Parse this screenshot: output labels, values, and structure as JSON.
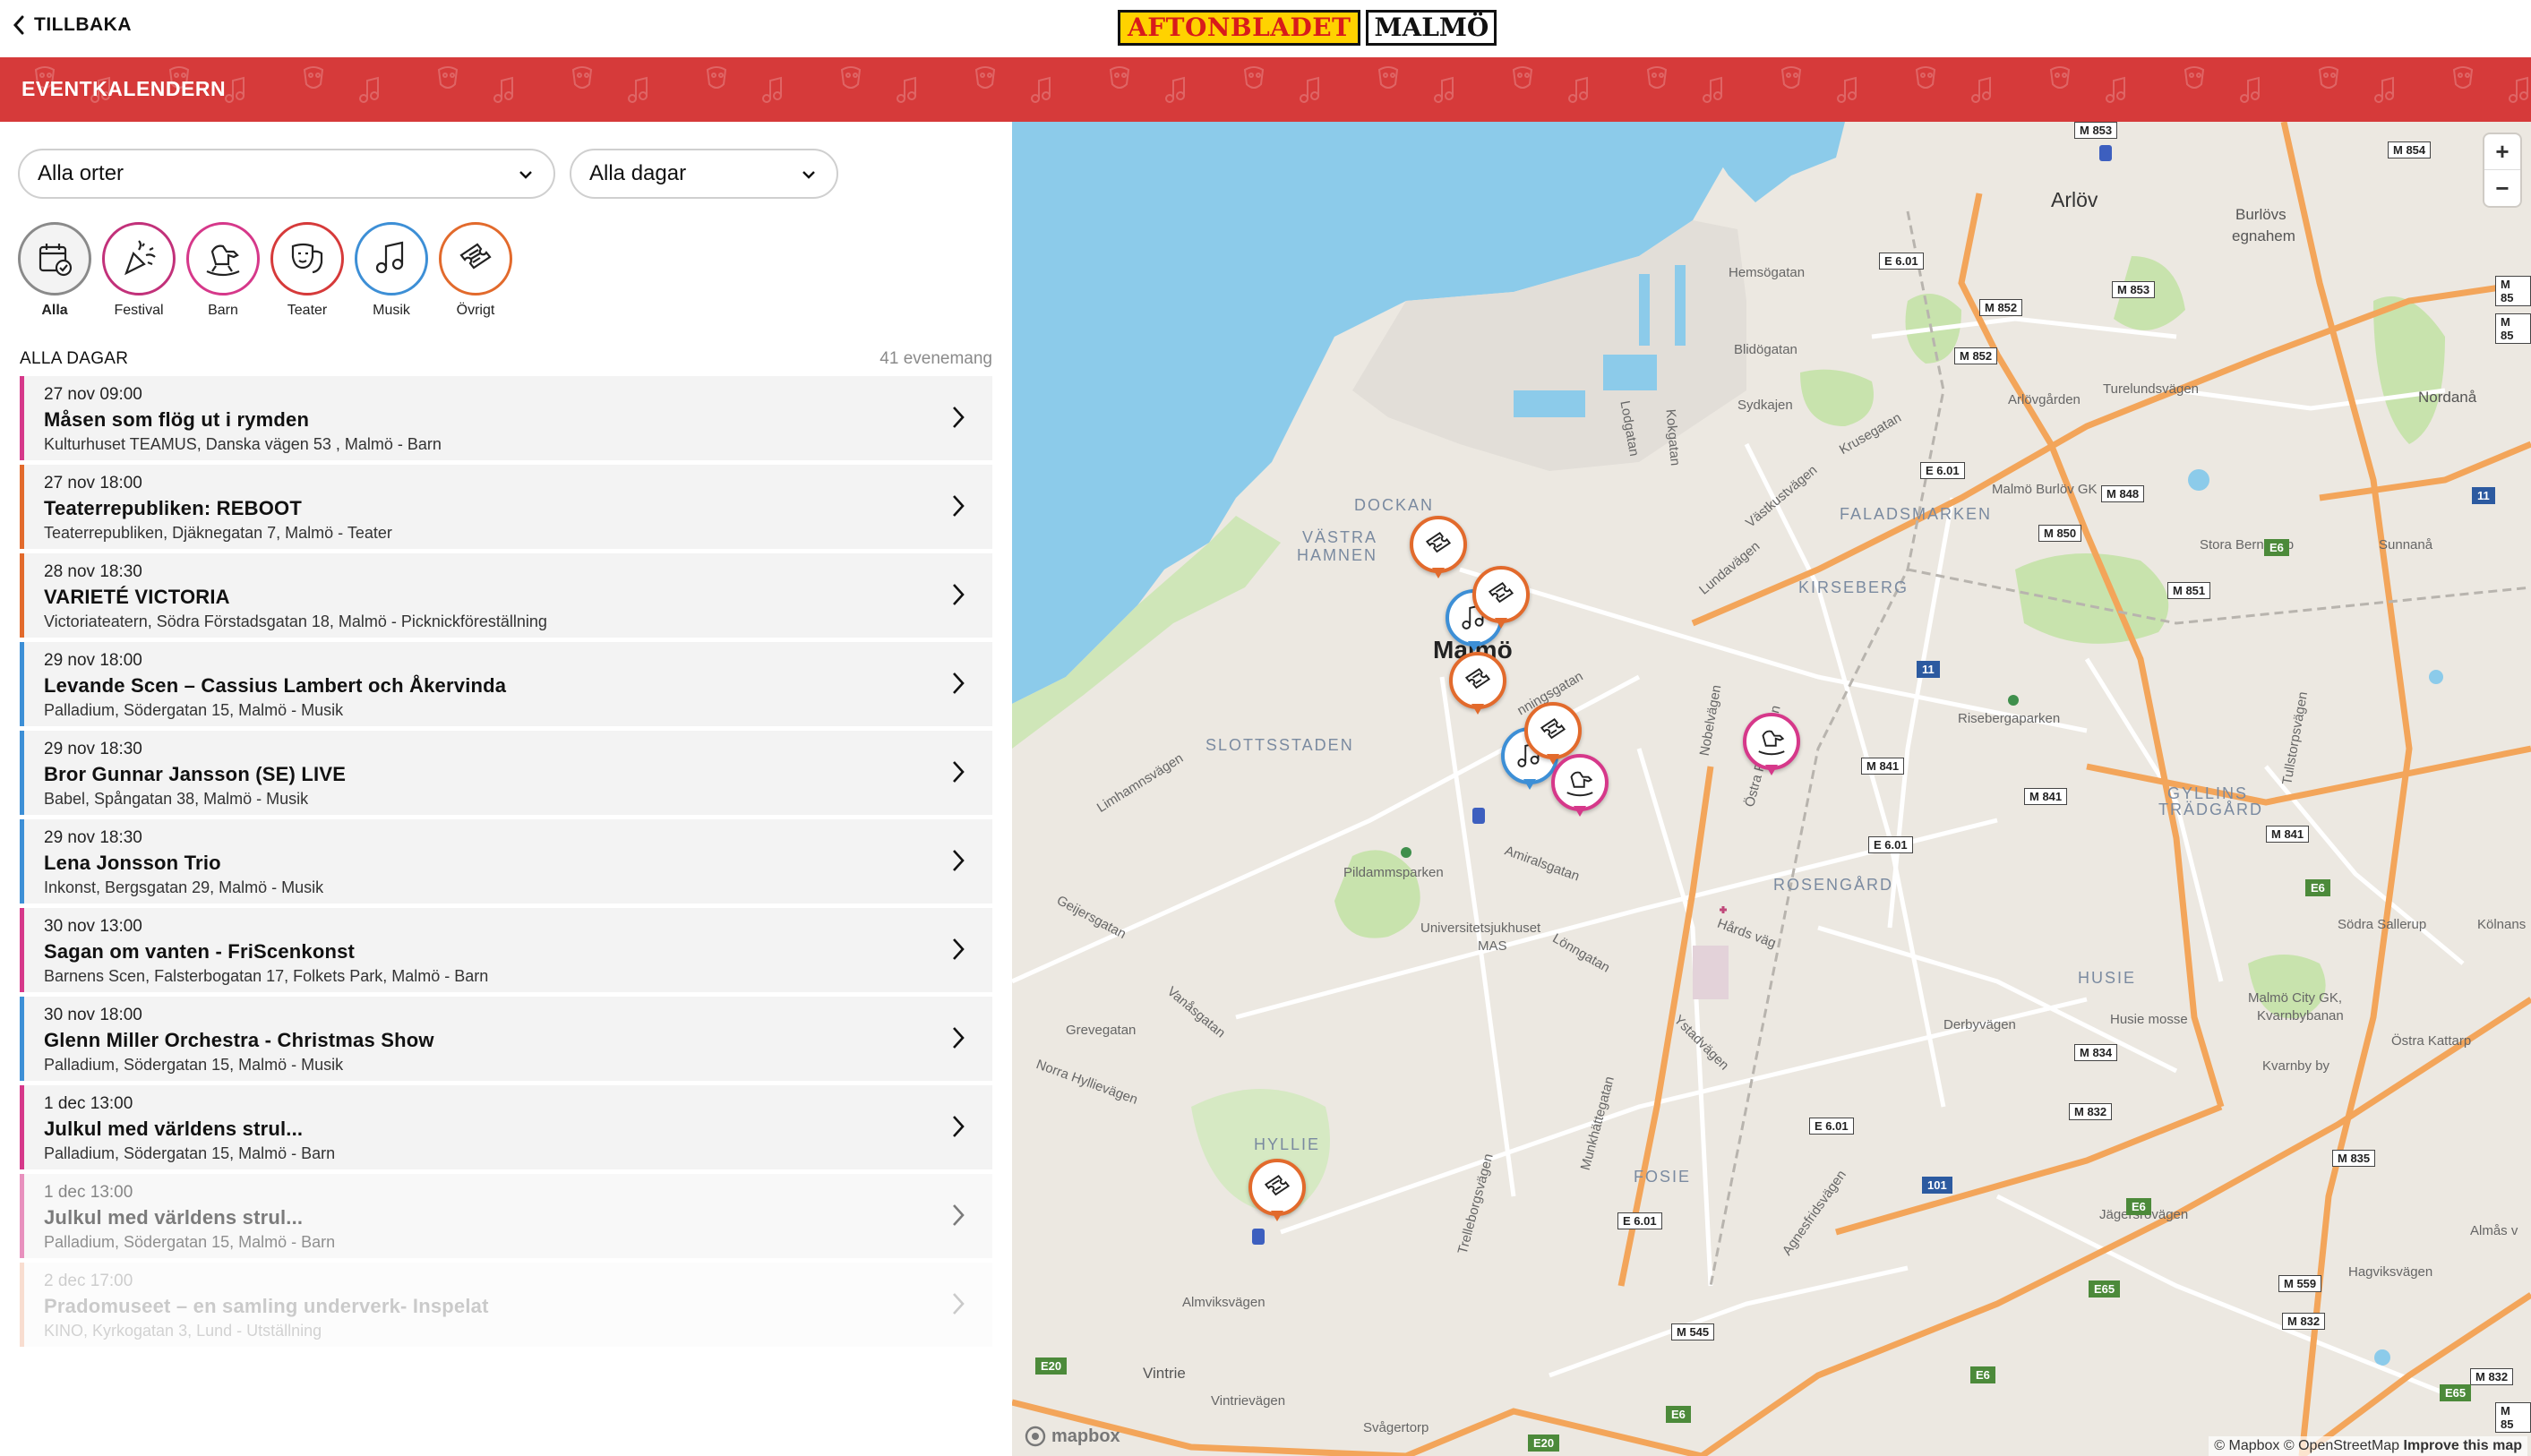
{
  "header": {
    "back_label": "TILLBAKA",
    "logo_brand": "AFTONBLADET",
    "logo_city": "MALMÖ",
    "section_title": "EVENTKALENDERN"
  },
  "filters": {
    "location": "Alla orter",
    "days": "Alla dagar"
  },
  "categories": [
    {
      "label": "Alla",
      "icon": "calendar-check-icon",
      "color": "#8a8a8a",
      "active": true
    },
    {
      "label": "Festival",
      "icon": "party-popper-icon",
      "color": "#c2317a"
    },
    {
      "label": "Barn",
      "icon": "rocking-horse-icon",
      "color": "#d6388a"
    },
    {
      "label": "Teater",
      "icon": "theater-masks-icon",
      "color": "#d63a3a"
    },
    {
      "label": "Musik",
      "icon": "music-note-icon",
      "color": "#3d8fd6"
    },
    {
      "label": "Övrigt",
      "icon": "ticket-icon",
      "color": "#e26a2c"
    }
  ],
  "list": {
    "heading": "ALLA DAGAR",
    "count": "41 evenemang",
    "events": [
      {
        "datetime": "27 nov 09:00",
        "name": "Måsen som flög ut i rymden",
        "location": "Kulturhuset TEAMUS, Danska vägen 53 , Malmö - Barn",
        "color": "#d6388a"
      },
      {
        "datetime": "27 nov 18:00",
        "name": "Teaterrepubliken: REBOOT",
        "location": "Teaterrepubliken, Djäknegatan 7, Malmö - Teater",
        "color": "#e26a2c"
      },
      {
        "datetime": "28 nov 18:30",
        "name": "VARIETÉ VICTORIA",
        "location": "Victoriateatern, Södra Förstadsgatan 18, Malmö - Picknickföreställning",
        "color": "#e26a2c"
      },
      {
        "datetime": "29 nov 18:00",
        "name": "Levande Scen – Cassius Lambert och Åkervinda",
        "location": "Palladium, Södergatan 15, Malmö - Musik",
        "color": "#3d8fd6"
      },
      {
        "datetime": "29 nov 18:30",
        "name": "Bror Gunnar Jansson (SE) LIVE",
        "location": "Babel, Spångatan 38, Malmö - Musik",
        "color": "#3d8fd6"
      },
      {
        "datetime": "29 nov 18:30",
        "name": "Lena Jonsson Trio",
        "location": "Inkonst, Bergsgatan 29, Malmö - Musik",
        "color": "#3d8fd6"
      },
      {
        "datetime": "30 nov 13:00",
        "name": "Sagan om vanten - FriScenkonst",
        "location": "Barnens Scen, Falsterbogatan 17, Folkets Park, Malmö - Barn",
        "color": "#d6388a"
      },
      {
        "datetime": "30 nov 18:00",
        "name": "Glenn Miller Orchestra - Christmas Show",
        "location": "Palladium, Södergatan 15, Malmö - Musik",
        "color": "#3d8fd6"
      },
      {
        "datetime": "1 dec 13:00",
        "name": "Julkul med världens strul...",
        "location": "Palladium, Södergatan 15, Malmö - Barn",
        "color": "#d6388a"
      },
      {
        "datetime": "1 dec 13:00",
        "name": "Julkul med världens strul...",
        "location": "Palladium, Södergatan 15, Malmö - Barn",
        "color": "#d6388a"
      },
      {
        "datetime": "2 dec 17:00",
        "name": "Pradomuseet – en samling underverk- Inspelat",
        "location": "KINO, Kyrkogatan 3, Lund - Utställning",
        "color": "#e26a2c"
      }
    ]
  },
  "map": {
    "zoom_in": "+",
    "zoom_out": "−",
    "logo": "mapbox",
    "attribution_1": "© Mapbox",
    "attribution_2": "© OpenStreetMap",
    "attribution_link": "Improve this map",
    "labels": {
      "arlov": "Arlöv",
      "burlovs": "Burlövs",
      "egnahem": "egnahem",
      "nordana": "Nordanå",
      "hemsogatan": "Hemsögatan",
      "blidogatan": "Blidögatan",
      "sydkajen": "Sydkajen",
      "arlovgarden": "Arlövgården",
      "turelund": "Turelundsvägen",
      "malmoburlov": "Malmö Burlöv GK",
      "faladsmarken": "FALADSMARKEN",
      "stora": "Stora Bernstorp",
      "sunnana": "Sunnanå",
      "dockan": "DOCKAN",
      "vastra": "VÄSTRA",
      "hamnen": "HAMNEN",
      "kirseberg": "KIRSEBERG",
      "malmo": "Malmö",
      "slottsstaden": "SLOTTSSTADEN",
      "risebergaparken": "Risebergaparken",
      "gyllins": "GYLLINS",
      "tradgard": "TRÄDGÅRD",
      "pildammsparken": "Pildammsparken",
      "universitet": "Universitetsjukhuset",
      "mas": "MAS",
      "rosengard": "ROSENGÅRD",
      "husie": "HUSIE",
      "husiemosse": "Husie mosse",
      "sodrasallerup": "Södra Sallerup",
      "kolnans": "Kölnans",
      "malmocity": "Malmö City GK,",
      "kvarnby": "Kvarnbybanan",
      "kvarnbyby": "Kvarnby by",
      "ostrakattarp": "Östra Kattarp",
      "hyllie": "HYLLIE",
      "fosie": "FOSIE",
      "almviksvagen": "Almviksvägen",
      "vintrie": "Vintrie",
      "vintrievagen": "Vintrievägen",
      "svagertorp": "Svågertorp",
      "jagersro": "Jägersrovägen",
      "hagvik": "Hagviksvägen",
      "almas": "Almås v",
      "limhamns": "Limhamnsvägen",
      "geijers": "Geijersgatan",
      "grevegatan": "Grevegatan",
      "vanasgatan": "Vanåsgatan",
      "norra": "Norra Hyllievägen",
      "lundavagen": "Lundavägen",
      "vastkust": "Västkustvägen",
      "krusegatan": "Krusegatan",
      "nobelvagen": "Nobelvägen",
      "ostrafarm": "Östra Farmvägen",
      "amiralsgatan": "Amiralsgatan",
      "lonngatan": "Lönngatan",
      "hardsvag": "Hårds väg",
      "ystadvagen": "Ystadvägen",
      "derbyvagen": "Derbyvägen",
      "munkhatte": "Munkhättegatan",
      "trelleborg": "Trelleborgsvägen",
      "agnesfrid": "Agnesfridsvägen",
      "tullstorp": "Tullstorpsvägen",
      "lodgatan": "Lodgatan",
      "kokgatan": "Kokgatan",
      "ssingsgatan": "nningsgatan"
    },
    "shields": [
      "M 853",
      "M 854",
      "E 6.01",
      "M 852",
      "M 852",
      "M 853",
      "M 85",
      "E 6.01",
      "M 848",
      "M 850",
      "M 851",
      "11",
      "11",
      "M 841",
      "M 841",
      "E 6.01",
      "M 841",
      "E6",
      "E6",
      "M 834",
      "M 832",
      "E 6.01",
      "101",
      "E 6.01",
      "E6",
      "M 835",
      "M 559",
      "E65",
      "M 832",
      "M 545",
      "E20",
      "E6",
      "E6",
      "E20",
      "M 832",
      "E65",
      "M 85",
      "M 85"
    ]
  }
}
